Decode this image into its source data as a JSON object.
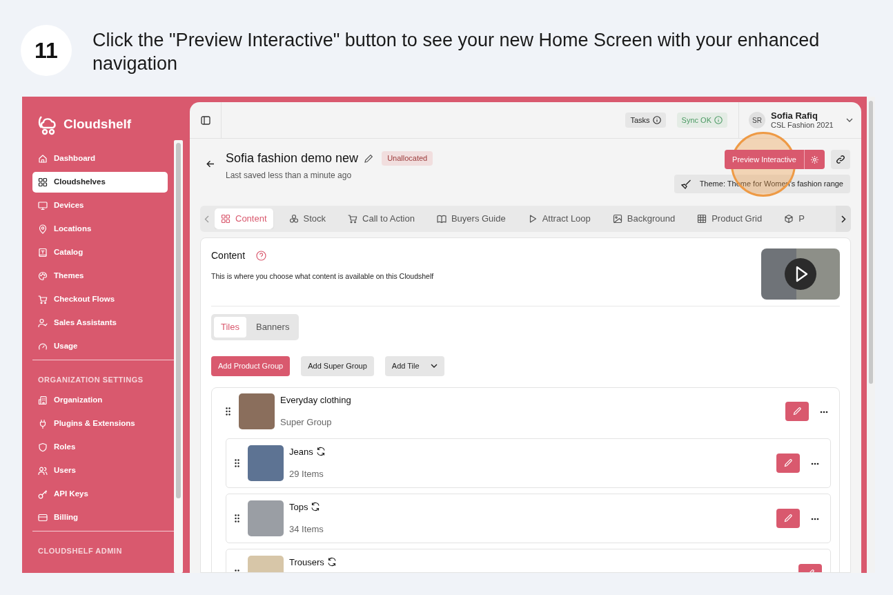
{
  "step": {
    "number": "11",
    "text": "Click the \"Preview Interactive\" button to see your new Home Screen with your enhanced navigation"
  },
  "sidebar": {
    "brand": "Cloudshelf",
    "sections": [
      {
        "items": [
          {
            "label": "Dashboard",
            "selected": false
          },
          {
            "label": "Cloudshelves",
            "selected": true
          },
          {
            "label": "Devices",
            "selected": false
          },
          {
            "label": "Locations",
            "selected": false
          },
          {
            "label": "Catalog",
            "selected": false
          },
          {
            "label": "Themes",
            "selected": false
          },
          {
            "label": "Checkout Flows",
            "selected": false
          },
          {
            "label": "Sales Assistants",
            "selected": false
          },
          {
            "label": "Usage",
            "selected": false
          }
        ]
      },
      {
        "heading": "ORGANIZATION SETTINGS",
        "items": [
          {
            "label": "Organization",
            "selected": false
          },
          {
            "label": "Plugins & Extensions",
            "selected": false
          },
          {
            "label": "Roles",
            "selected": false
          },
          {
            "label": "Users",
            "selected": false
          },
          {
            "label": "API Keys",
            "selected": false
          },
          {
            "label": "Billing",
            "selected": false
          }
        ]
      },
      {
        "heading": "CLOUDSHELF ADMIN"
      }
    ]
  },
  "topbar": {
    "tasks": "Tasks",
    "sync": "Sync OK",
    "user": {
      "initials": "SR",
      "name": "Sofia Rafiq",
      "organization": "CSL Fashion 2021"
    }
  },
  "header": {
    "title": "Sofia fashion demo new",
    "status": "Unallocated",
    "saved": "Last saved less than a minute ago",
    "preview_button": "Preview Interactive",
    "theme": "Theme: Theme for Women's fashion range"
  },
  "tabs": [
    {
      "label": "Content",
      "selected": true
    },
    {
      "label": "Stock",
      "selected": false
    },
    {
      "label": "Call to Action",
      "selected": false
    },
    {
      "label": "Buyers Guide",
      "selected": false
    },
    {
      "label": "Attract Loop",
      "selected": false
    },
    {
      "label": "Background",
      "selected": false
    },
    {
      "label": "Product Grid",
      "selected": false
    },
    {
      "label": "P",
      "selected": false
    }
  ],
  "content": {
    "title": "Content",
    "description": "This is where you choose what content is available on this Cloudshelf"
  },
  "view_toggle": [
    {
      "label": "Tiles",
      "selected": true
    },
    {
      "label": "Banners",
      "selected": false
    }
  ],
  "actions": [
    {
      "label": "Add Product Group",
      "kind": "primary"
    },
    {
      "label": "Add Super Group",
      "kind": "secondary"
    },
    {
      "label": "Add Tile",
      "kind": "dropdown"
    }
  ],
  "groups": [
    {
      "title": "Everyday clothing",
      "subtitle": "Super Group",
      "children": [
        {
          "title": "Jeans",
          "subtitle": "29 Items"
        },
        {
          "title": "Tops",
          "subtitle": "34 Items"
        },
        {
          "title": "Trousers"
        }
      ]
    }
  ]
}
